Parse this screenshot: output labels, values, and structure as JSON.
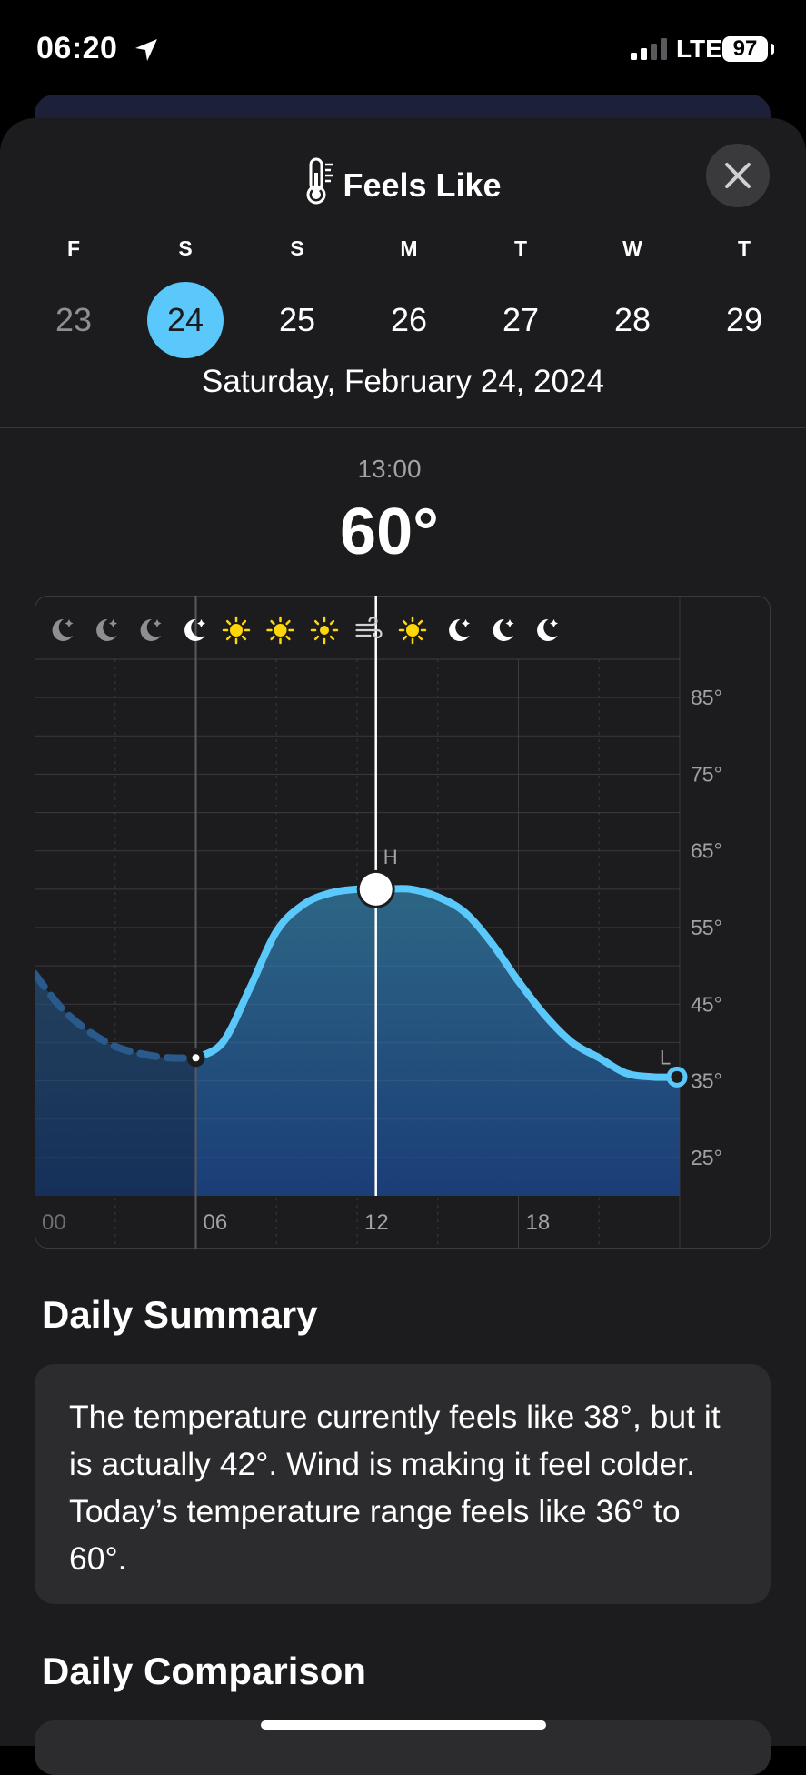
{
  "status": {
    "time": "06:20",
    "carrier": "LTE",
    "battery": "97"
  },
  "header": {
    "title": "Feels Like"
  },
  "days": [
    {
      "letter": "F",
      "num": "23",
      "state": "past"
    },
    {
      "letter": "S",
      "num": "24",
      "state": "selected"
    },
    {
      "letter": "S",
      "num": "25",
      "state": "future"
    },
    {
      "letter": "M",
      "num": "26",
      "state": "future"
    },
    {
      "letter": "T",
      "num": "27",
      "state": "future"
    },
    {
      "letter": "W",
      "num": "28",
      "state": "future"
    },
    {
      "letter": "T",
      "num": "29",
      "state": "future"
    }
  ],
  "selected_date": "Saturday, February 24, 2024",
  "selection": {
    "time": "13:00",
    "temp": "60°"
  },
  "chart_data": {
    "type": "area",
    "x_tick_labels": [
      "00",
      "06",
      "12",
      "18"
    ],
    "y_tick_labels": [
      "85°",
      "75°",
      "65°",
      "55°",
      "45°",
      "35°",
      "25°"
    ],
    "ylim": [
      20,
      90
    ],
    "xlim": [
      0,
      24
    ],
    "high_label": "H",
    "low_label": "L",
    "weather_icons": [
      "moon",
      "moon",
      "moon",
      "moon",
      "sun",
      "sun",
      "sun",
      "wind",
      "sun",
      "moon",
      "moon",
      "moon"
    ],
    "past_points": [
      [
        0,
        49
      ],
      [
        1,
        44.5
      ],
      [
        2,
        41.5
      ],
      [
        3,
        39.5
      ],
      [
        4,
        38.5
      ],
      [
        5,
        38
      ],
      [
        6,
        38
      ]
    ],
    "forecast_points": [
      [
        6,
        38
      ],
      [
        7,
        40
      ],
      [
        8,
        47
      ],
      [
        9,
        54.5
      ],
      [
        10,
        58
      ],
      [
        11,
        59.5
      ],
      [
        12,
        60
      ],
      [
        13,
        60
      ],
      [
        14,
        60
      ],
      [
        15,
        59
      ],
      [
        16,
        57
      ],
      [
        17,
        53
      ],
      [
        18,
        48
      ],
      [
        19,
        43.5
      ],
      [
        20,
        40
      ],
      [
        21,
        38
      ],
      [
        22,
        36
      ],
      [
        23,
        35.5
      ],
      [
        24,
        35.5
      ]
    ],
    "current_hour": 6,
    "current_value": 38,
    "selected_hour": 12.7,
    "selected_value": 60,
    "colors": {
      "line": "#5ac8fa",
      "fill_top": "#2e6a8a",
      "fill_bottom": "#1b3f7c",
      "past_fill": "#1e3a5f"
    }
  },
  "daily_summary": {
    "heading": "Daily Summary",
    "text": "The temperature currently feels like 38°, but it is actually 42°. Wind is making it feel colder. Today’s temperature range feels like 36° to 60°."
  },
  "daily_comparison": {
    "heading": "Daily Comparison"
  }
}
